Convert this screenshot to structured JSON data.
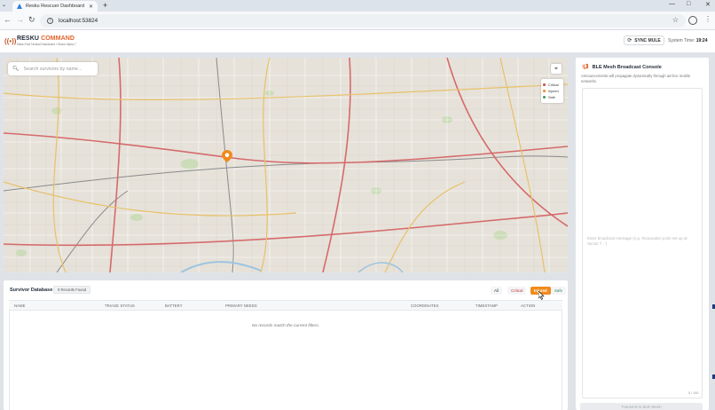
{
  "browser": {
    "tab_title": "Resku Rescuer Dashboard",
    "url": "localhost:53824",
    "new_tab": "+",
    "win_min": "—",
    "win_max": "□",
    "win_close": "✕"
  },
  "header": {
    "brand_part1": "RESKU",
    "brand_part2": "COMMAND",
    "subtitle": "Mass-Post Tactical Dashboard • Sector Alpha-7",
    "sync_label": "SYNC MULE",
    "systime_label": "System Time:",
    "systime_value": "19:24"
  },
  "map": {
    "search_placeholder": "Search survivors by name...",
    "legend": [
      {
        "label": "Critical",
        "color": "#d64545"
      },
      {
        "label": "Injured",
        "color": "#f08a1d"
      },
      {
        "label": "Safe",
        "color": "#3a9a5b"
      }
    ],
    "marker_color": "#f08a1d"
  },
  "database": {
    "title": "Survivor Database",
    "count": "0 Records Found",
    "filters": {
      "all": "All",
      "critical": "Critical",
      "injured": "Injured",
      "safe": "Safe"
    },
    "columns": {
      "name": "NAME",
      "triage": "TRIAGE STATUS",
      "battery": "BATTERY",
      "needs": "PRIMARY NEEDS",
      "coords": "COORDINATES",
      "timestamp": "TIMESTAMP",
      "action": "ACTION"
    },
    "empty_message": "No records match the current filters."
  },
  "broadcast": {
    "title": "BLE Mesh Broadcast Console",
    "description": "Announcements will propagate dynamically through ad-hoc mobile networks.",
    "placeholder": "Enter broadcast message (e.g. 'Evacuation point set up at Sector 7...')",
    "char_count": "0 / 160",
    "transmit_label": "Transmit to BLE Mesh"
  }
}
